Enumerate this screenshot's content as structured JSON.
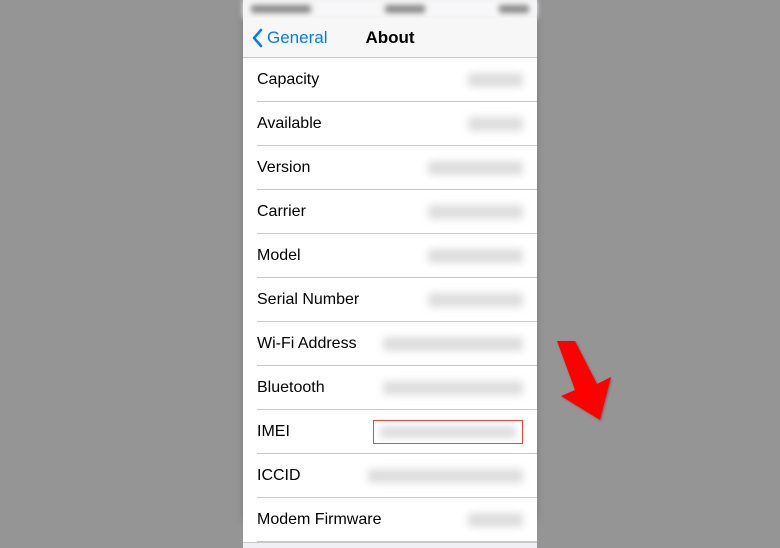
{
  "nav": {
    "back_label": "General",
    "title": "About"
  },
  "rows": {
    "capacity": {
      "label": "Capacity"
    },
    "available": {
      "label": "Available"
    },
    "version": {
      "label": "Version"
    },
    "carrier": {
      "label": "Carrier"
    },
    "model": {
      "label": "Model"
    },
    "serial": {
      "label": "Serial Number"
    },
    "wifi": {
      "label": "Wi-Fi Address"
    },
    "bluetooth": {
      "label": "Bluetooth"
    },
    "imei": {
      "label": "IMEI"
    },
    "iccid": {
      "label": "ICCID"
    },
    "modem": {
      "label": "Modem Firmware"
    }
  }
}
